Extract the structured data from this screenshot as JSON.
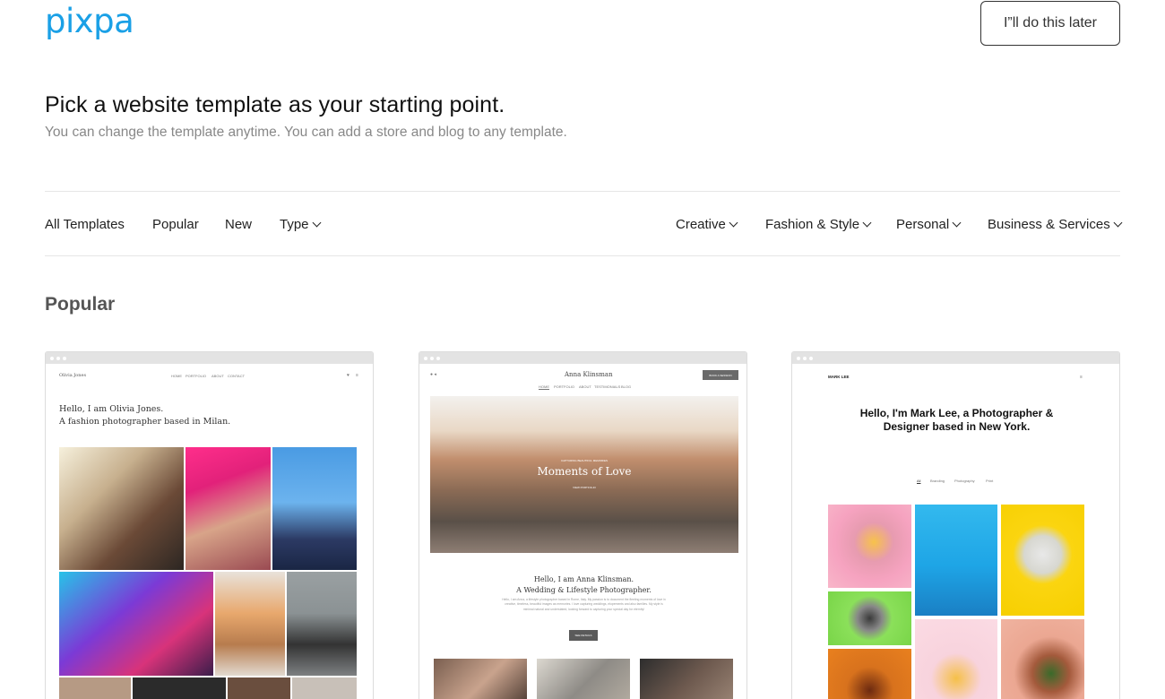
{
  "header": {
    "logo": "pixpa",
    "later_label": "I”ll do this later"
  },
  "intro": {
    "title": "Pick a website template as your starting point.",
    "subtitle": "You can change the template anytime. You can add a store and blog to any template."
  },
  "filters": {
    "left": [
      {
        "label": "All Templates"
      },
      {
        "label": "Popular"
      },
      {
        "label": "New"
      },
      {
        "label": "Type"
      }
    ],
    "right": [
      {
        "label": "Creative"
      },
      {
        "label": "Fashion & Style"
      },
      {
        "label": "Personal"
      },
      {
        "label": "Business & Services"
      }
    ]
  },
  "section": {
    "title": "Popular"
  },
  "templates": [
    {
      "site_name": "Olivia Jones",
      "nav": [
        "HOME",
        "PORTFOLIO",
        "ABOUT",
        "CONTACT"
      ],
      "intro_line1": "Hello, I am Olivia Jones.",
      "intro_line2": "A fashion photographer based in Milan."
    },
    {
      "site_name": "Anna Klinsman",
      "nav": [
        "HOME",
        "PORTFOLIO",
        "ABOUT",
        "TESTIMONIALS",
        "BLOG"
      ],
      "cta": "BOOK A SESSION",
      "hero_small": "CAPTURING BEAUTIFUL MEMORIES",
      "hero_title": "Moments of Love",
      "hero_btn": "VIEW PORTFOLIO",
      "intro_line1": "Hello, I am Anna Klinsman.",
      "intro_line2": "A Wedding & Lifestyle Photographer.",
      "body": "Hello, I am Anna, a lifestyle photographer based in Rome, Italy. My passion is to document the fleeting moments of love in creative, timeless, beautiful images as memories. I love capturing weddings, elopements and also families. My style is minimal natural and understated, looking forward to capturing your special day for eternity!",
      "btn": "SEE DETAILS"
    },
    {
      "site_name": "MARK LEE",
      "heading": "Hello, I'm Mark Lee, a Photographer & Designer based in New York.",
      "tabs": [
        "All",
        "Branding",
        "Photography",
        "Print"
      ]
    }
  ]
}
